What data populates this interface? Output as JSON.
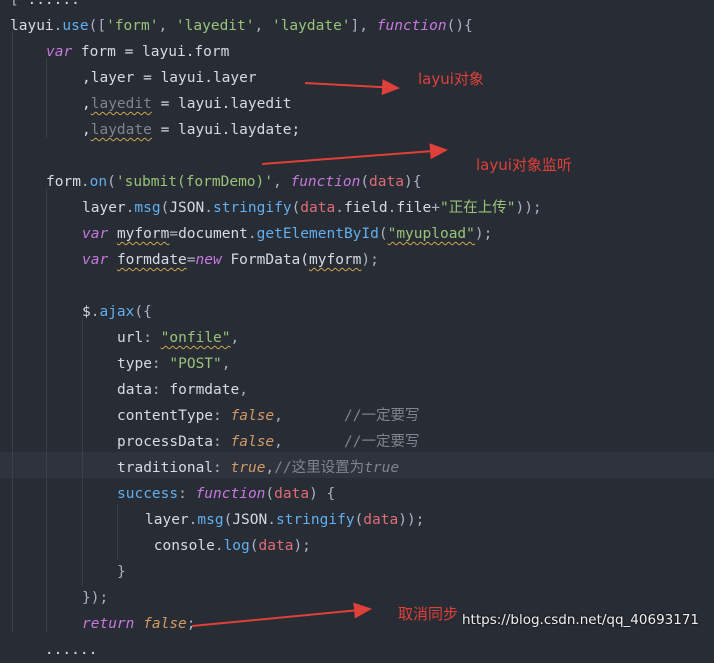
{
  "code_lines": [
    {
      "indent": 0,
      "tokens": [
        [
          "t-punc",
          "[ "
        ],
        [
          "t-plain",
          "......"
        ]
      ]
    },
    {
      "indent": 0,
      "tokens": [
        [
          "t-plain",
          "layui"
        ],
        [
          "t-punc",
          "."
        ],
        [
          "t-fn",
          "use"
        ],
        [
          "t-punc",
          "(["
        ],
        [
          "t-str",
          "'form'"
        ],
        [
          "t-punc",
          ", "
        ],
        [
          "t-str",
          "'layedit'"
        ],
        [
          "t-punc",
          ", "
        ],
        [
          "t-str",
          "'laydate'"
        ],
        [
          "t-punc",
          "], "
        ],
        [
          "t-kw",
          "function"
        ],
        [
          "t-punc",
          "(){"
        ]
      ]
    },
    {
      "indent": 1,
      "tokens": [
        [
          "t-kw",
          "var"
        ],
        [
          "t-plain",
          " form = layui.form"
        ]
      ]
    },
    {
      "indent": 2,
      "tokens": [
        [
          "t-plain",
          ",layer = layui.layer"
        ]
      ]
    },
    {
      "indent": 2,
      "tokens": [
        [
          "t-plain",
          ","
        ],
        [
          "t-cmt squiggle",
          "layedit"
        ],
        [
          "t-plain",
          " = layui.layedit"
        ]
      ]
    },
    {
      "indent": 2,
      "tokens": [
        [
          "t-plain",
          ","
        ],
        [
          "t-cmt squiggle",
          "laydate"
        ],
        [
          "t-plain",
          " = layui.laydate;"
        ]
      ]
    },
    {
      "indent": 0,
      "tokens": []
    },
    {
      "indent": 1,
      "tokens": [
        [
          "t-plain",
          "form"
        ],
        [
          "t-punc",
          "."
        ],
        [
          "t-fn",
          "on"
        ],
        [
          "t-punc",
          "("
        ],
        [
          "t-str",
          "'submit(formDemo)'"
        ],
        [
          "t-punc",
          ", "
        ],
        [
          "t-kw",
          "function"
        ],
        [
          "t-punc",
          "("
        ],
        [
          "t-param",
          "data"
        ],
        [
          "t-punc",
          "){"
        ]
      ]
    },
    {
      "indent": 2,
      "tokens": [
        [
          "t-plain",
          "layer"
        ],
        [
          "t-punc",
          "."
        ],
        [
          "t-fn",
          "msg"
        ],
        [
          "t-punc",
          "("
        ],
        [
          "t-plain",
          "JSON"
        ],
        [
          "t-punc",
          "."
        ],
        [
          "t-fn",
          "stringify"
        ],
        [
          "t-punc",
          "("
        ],
        [
          "t-param",
          "data"
        ],
        [
          "t-punc",
          "."
        ],
        [
          "t-plain",
          "field"
        ],
        [
          "t-punc",
          "."
        ],
        [
          "t-plain",
          "file"
        ],
        [
          "t-punc",
          "+"
        ],
        [
          "t-str",
          "\"正在上传\""
        ],
        [
          "t-punc",
          "));"
        ]
      ]
    },
    {
      "indent": 2,
      "tokens": [
        [
          "t-kw",
          "var"
        ],
        [
          "t-plain",
          " "
        ],
        [
          "t-plain squiggle",
          "myform"
        ],
        [
          "t-punc",
          "="
        ],
        [
          "t-plain",
          "document"
        ],
        [
          "t-punc",
          "."
        ],
        [
          "t-fn",
          "getElementById"
        ],
        [
          "t-punc",
          "("
        ],
        [
          "t-str squiggle",
          "\"myupload\""
        ],
        [
          "t-punc",
          ");"
        ]
      ]
    },
    {
      "indent": 2,
      "tokens": [
        [
          "t-kw",
          "var"
        ],
        [
          "t-plain",
          " "
        ],
        [
          "t-plain squiggle",
          "formdate"
        ],
        [
          "t-punc",
          "="
        ],
        [
          "t-kw",
          "new"
        ],
        [
          "t-plain",
          " FormData("
        ],
        [
          "t-plain squiggle",
          "myform"
        ],
        [
          "t-punc",
          ");"
        ]
      ]
    },
    {
      "indent": 0,
      "tokens": []
    },
    {
      "indent": 2,
      "tokens": [
        [
          "t-plain",
          "$"
        ],
        [
          "t-punc",
          "."
        ],
        [
          "t-fn",
          "ajax"
        ],
        [
          "t-punc",
          "({"
        ]
      ]
    },
    {
      "indent": 3,
      "tokens": [
        [
          "t-plain",
          "url"
        ],
        [
          "t-punc",
          ": "
        ],
        [
          "t-str squiggle",
          "\"onfile\""
        ],
        [
          "t-punc",
          ","
        ]
      ]
    },
    {
      "indent": 3,
      "tokens": [
        [
          "t-plain",
          "type"
        ],
        [
          "t-punc",
          ": "
        ],
        [
          "t-str",
          "\"POST\""
        ],
        [
          "t-punc",
          ","
        ]
      ]
    },
    {
      "indent": 3,
      "tokens": [
        [
          "t-plain",
          "data"
        ],
        [
          "t-punc",
          ": "
        ],
        [
          "t-plain",
          "formdate"
        ],
        [
          "t-punc",
          ","
        ]
      ]
    },
    {
      "indent": 3,
      "tokens": [
        [
          "t-plain",
          "contentType"
        ],
        [
          "t-punc",
          ": "
        ],
        [
          "t-const",
          "false"
        ],
        [
          "t-punc",
          ","
        ],
        [
          "t-plain",
          "       "
        ],
        [
          "t-cmt",
          "//一定要写"
        ]
      ]
    },
    {
      "indent": 3,
      "tokens": [
        [
          "t-plain",
          "processData"
        ],
        [
          "t-punc",
          ": "
        ],
        [
          "t-const",
          "false"
        ],
        [
          "t-punc",
          ","
        ],
        [
          "t-plain",
          "       "
        ],
        [
          "t-cmt",
          "//一定要写"
        ]
      ]
    },
    {
      "indent": 3,
      "tokens": [
        [
          "t-plain",
          "traditional"
        ],
        [
          "t-punc",
          ": "
        ],
        [
          "t-const",
          "true"
        ],
        [
          "t-punc",
          ","
        ],
        [
          "t-cmt",
          "//这里设置为"
        ],
        [
          "t-cmt-i",
          "true"
        ]
      ]
    },
    {
      "indent": 3,
      "tokens": [
        [
          "t-fn",
          "success"
        ],
        [
          "t-punc",
          ": "
        ],
        [
          "t-kw",
          "function"
        ],
        [
          "t-punc",
          "("
        ],
        [
          "t-param",
          "data"
        ],
        [
          "t-punc",
          ") {"
        ]
      ]
    },
    {
      "indent": 4,
      "tokens": [
        [
          "t-plain",
          "layer"
        ],
        [
          "t-punc",
          "."
        ],
        [
          "t-fn",
          "msg"
        ],
        [
          "t-punc",
          "("
        ],
        [
          "t-plain",
          "JSON"
        ],
        [
          "t-punc",
          "."
        ],
        [
          "t-fn",
          "stringify"
        ],
        [
          "t-punc",
          "("
        ],
        [
          "t-param",
          "data"
        ],
        [
          "t-punc",
          "));"
        ]
      ]
    },
    {
      "indent": 4,
      "tokens": [
        [
          "t-plain",
          " console"
        ],
        [
          "t-punc",
          "."
        ],
        [
          "t-fn",
          "log"
        ],
        [
          "t-punc",
          "("
        ],
        [
          "t-param",
          "data"
        ],
        [
          "t-punc",
          ");"
        ]
      ]
    },
    {
      "indent": 3,
      "tokens": [
        [
          "t-punc",
          "}"
        ]
      ]
    },
    {
      "indent": 2,
      "tokens": [
        [
          "t-punc",
          "});"
        ]
      ]
    },
    {
      "indent": 2,
      "tokens": [
        [
          "t-kw",
          "return"
        ],
        [
          "t-plain",
          " "
        ],
        [
          "t-const",
          "false"
        ],
        [
          "t-punc",
          ";"
        ]
      ]
    },
    {
      "indent": 0,
      "tokens": [
        [
          "t-plain",
          "    ......"
        ]
      ]
    }
  ],
  "annotations": {
    "layui_objects": "layui对象",
    "layui_listener": "layui对象监听",
    "cancel_sync": "取消同步"
  },
  "watermark": "https://blog.csdn.net/qq_40693171",
  "colors": {
    "background": "#282c34",
    "current_line": "#2f333d",
    "keyword": "#c678dd",
    "string": "#98c379",
    "function": "#61afef",
    "parameter": "#e06c75",
    "constant": "#d19a66",
    "comment": "#7f848e",
    "annotation": "#e0403a"
  }
}
